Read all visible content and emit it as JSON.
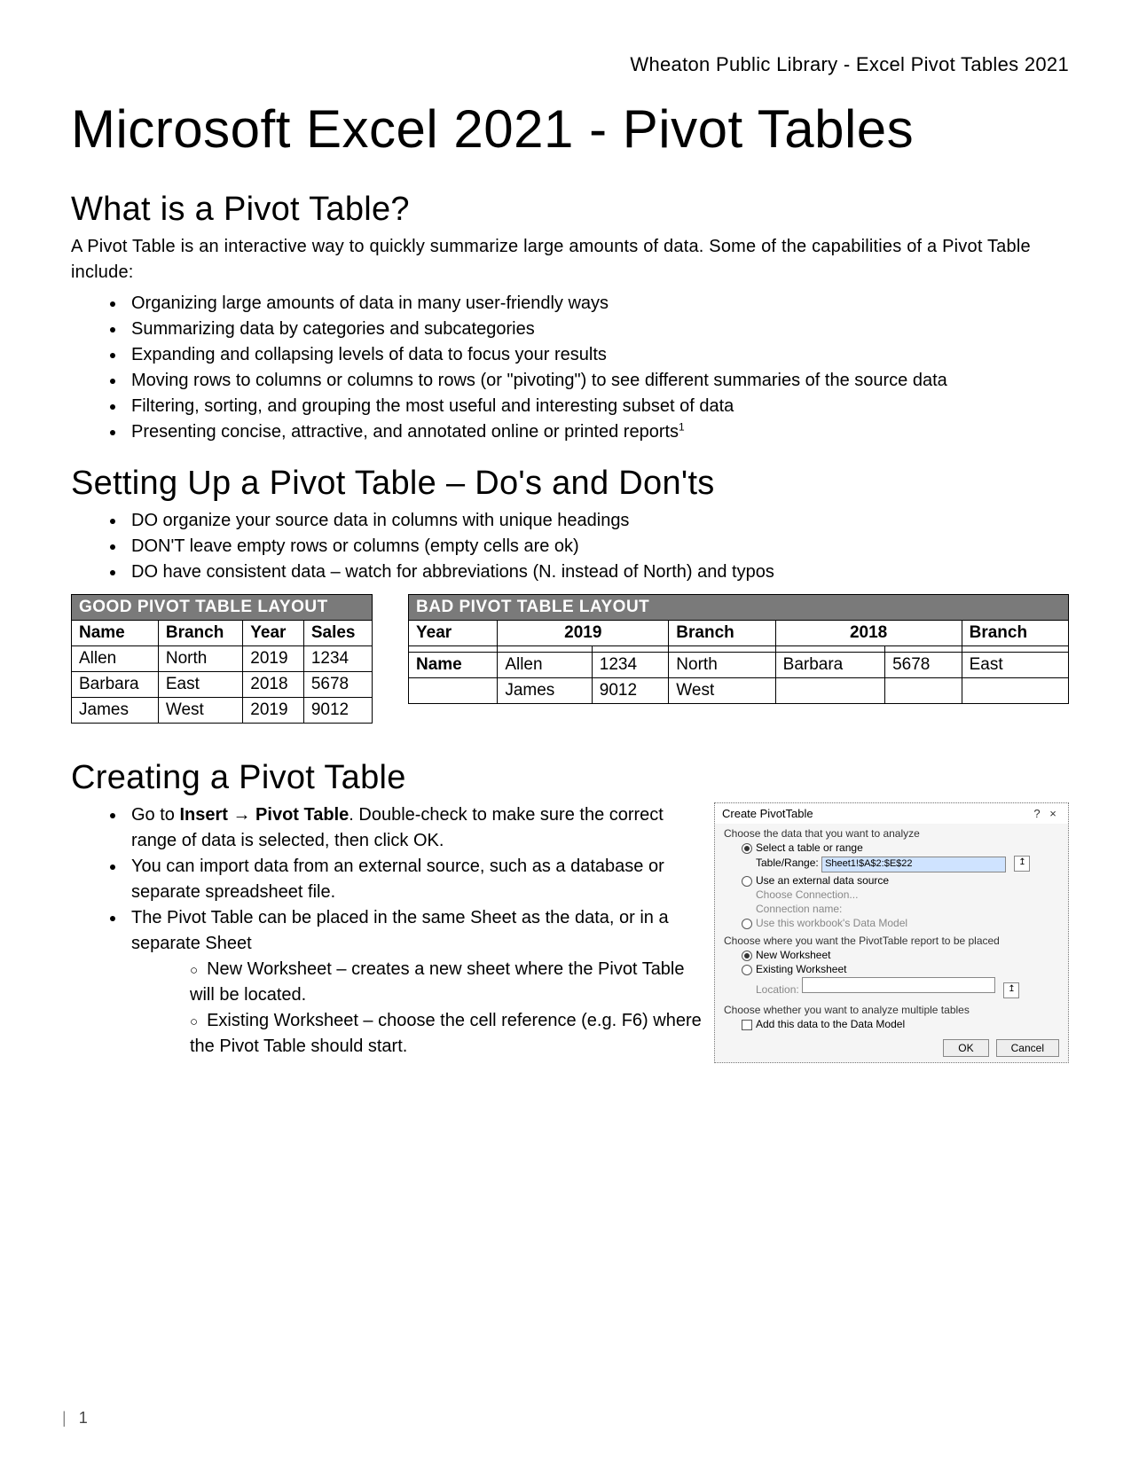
{
  "header": {
    "right": "Wheaton Public Library - Excel Pivot Tables 2021"
  },
  "title": "Microsoft Excel 2021 - Pivot Tables",
  "section1": {
    "heading": "What is a Pivot Table?",
    "intro": "A Pivot Table is an interactive way to quickly summarize large amounts of data. Some of the capabilities of a Pivot Table include:",
    "bullets": [
      "Organizing large amounts of data in many user-friendly ways",
      "Summarizing data by categories and subcategories",
      "Expanding and collapsing levels of data to focus your results",
      "Moving rows to columns or columns to rows (or \"pivoting\") to see different summaries of the source data",
      "Filtering, sorting, and grouping the most useful and interesting subset of data",
      "Presenting concise, attractive, and annotated online or printed reports"
    ],
    "footnote_marker": "1"
  },
  "section2": {
    "heading": "Setting Up a Pivot Table – Do's and Don'ts",
    "bullets": [
      "DO organize your source data in columns with unique headings",
      "DON'T leave empty rows or columns (empty cells are ok)",
      "DO have consistent data – watch for abbreviations (N. instead of North) and typos"
    ],
    "good": {
      "caption": "GOOD PIVOT TABLE LAYOUT",
      "headers": [
        "Name",
        "Branch",
        "Year",
        "Sales"
      ],
      "rows": [
        [
          "Allen",
          "North",
          "2019",
          "1234"
        ],
        [
          "Barbara",
          "East",
          "2018",
          "5678"
        ],
        [
          "James",
          "West",
          "2019",
          "9012"
        ]
      ]
    },
    "bad": {
      "caption": "BAD PIVOT TABLE LAYOUT",
      "row0": [
        "Year",
        "2019",
        "Branch",
        "2018",
        "Branch"
      ],
      "row1": [
        "",
        "",
        "",
        "",
        "",
        "",
        ""
      ],
      "row2": [
        "Name",
        "Allen",
        "1234",
        "North",
        "Barbara",
        "5678",
        "East"
      ],
      "row3": [
        "",
        "James",
        "9012",
        "West",
        "",
        "",
        ""
      ]
    }
  },
  "section3": {
    "heading": "Creating a Pivot Table",
    "b1_prefix": "Go to ",
    "b1_bold": "Insert → Pivot Table",
    "b1_suffix": ". Double-check to make sure the correct range of data is selected, then click OK.",
    "b2": "You can import data from an external source, such as a database or separate spreadsheet file.",
    "b3": "The Pivot Table can be placed in the same Sheet as the data, or in a separate Sheet",
    "b3a": "New Worksheet – creates a new sheet where the Pivot Table will be located.",
    "b3b": "Existing Worksheet – choose the cell reference (e.g. F6) where the Pivot Table should start."
  },
  "dialog": {
    "title": "Create PivotTable",
    "help": "?",
    "close": "×",
    "group1": "Choose the data that you want to analyze",
    "opt_select": "Select a table or range",
    "table_range_label": "Table/Range:",
    "table_range_value": "Sheet1!$A$2:$E$22",
    "opt_external": "Use an external data source",
    "choose_conn": "Choose Connection...",
    "conn_name": "Connection name:",
    "opt_datamodel": "Use this workbook's Data Model",
    "group2": "Choose where you want the PivotTable report to be placed",
    "opt_newws": "New Worksheet",
    "opt_existws": "Existing Worksheet",
    "location_label": "Location:",
    "group3": "Choose whether you want to analyze multiple tables",
    "opt_addmodel": "Add this data to the Data Model",
    "ok": "OK",
    "cancel": "Cancel"
  },
  "footer": {
    "bar": "|",
    "page": "1"
  }
}
